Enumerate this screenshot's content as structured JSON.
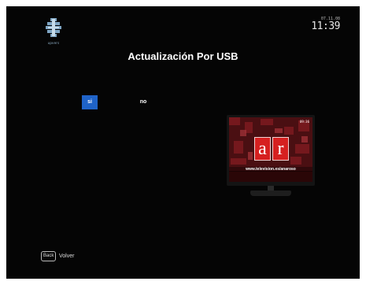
{
  "header": {
    "logo_icon": "upvers-logo-icon",
    "logo_text": "upvers",
    "date": "07.11.08",
    "time": "11:39"
  },
  "dialog": {
    "title": "Actualización Por USB",
    "options": [
      {
        "label": "si",
        "selected": true
      },
      {
        "label": "no",
        "selected": false
      }
    ],
    "accent_color": "#1f63c8"
  },
  "preview": {
    "icon": "tv-icon",
    "clock": "09:36",
    "logo_letters": [
      "a",
      "r"
    ],
    "url": "www.television.es/anaroso"
  },
  "footer": {
    "back_key": "Back",
    "back_label": "Volver"
  }
}
